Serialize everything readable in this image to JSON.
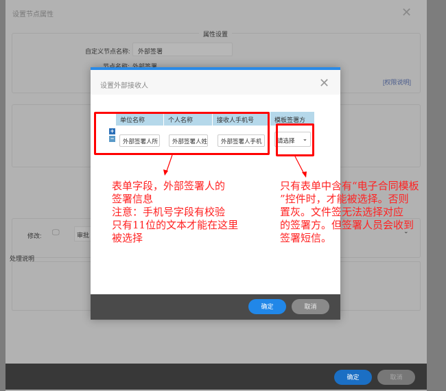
{
  "outer_dialog": {
    "title": "设置节点属性",
    "legend": "属性设置",
    "custom_name_label": "自定义节点名称:",
    "custom_name_value": "外部签署",
    "node_name_label": "节点名称:",
    "node_name_value": "外部签署",
    "permission_link": "[权限说明]",
    "modify_label": "修改:",
    "approve_select": "审批",
    "description_label": "处理说明",
    "ok": "确定",
    "cancel": "取消"
  },
  "inner_dialog": {
    "title": "设置外部接收人",
    "columns": [
      "单位名称",
      "个人名称",
      "接收人手机号",
      "模板签署方"
    ],
    "row": {
      "unit": "外部签署人所",
      "person": "外部签署人姓",
      "phone": "外部签署人手机",
      "signer_select": "请选择"
    },
    "ok": "确定",
    "cancel": "取消"
  },
  "annotations": {
    "left": "表单字段，外部签署人的\n签署信息\n注意：手机号字段有校验\n只有11位的文本才能在这里\n被选择",
    "right": "只有表单中含有“电子合同模板\n”控件时，才能被选择。否则\n置灰。文件签无法选择对应\n的签署方。但签署人员会收到\n签署短信。"
  },
  "colors": {
    "annotation": "#ff0000",
    "primary": "#2187e8"
  }
}
